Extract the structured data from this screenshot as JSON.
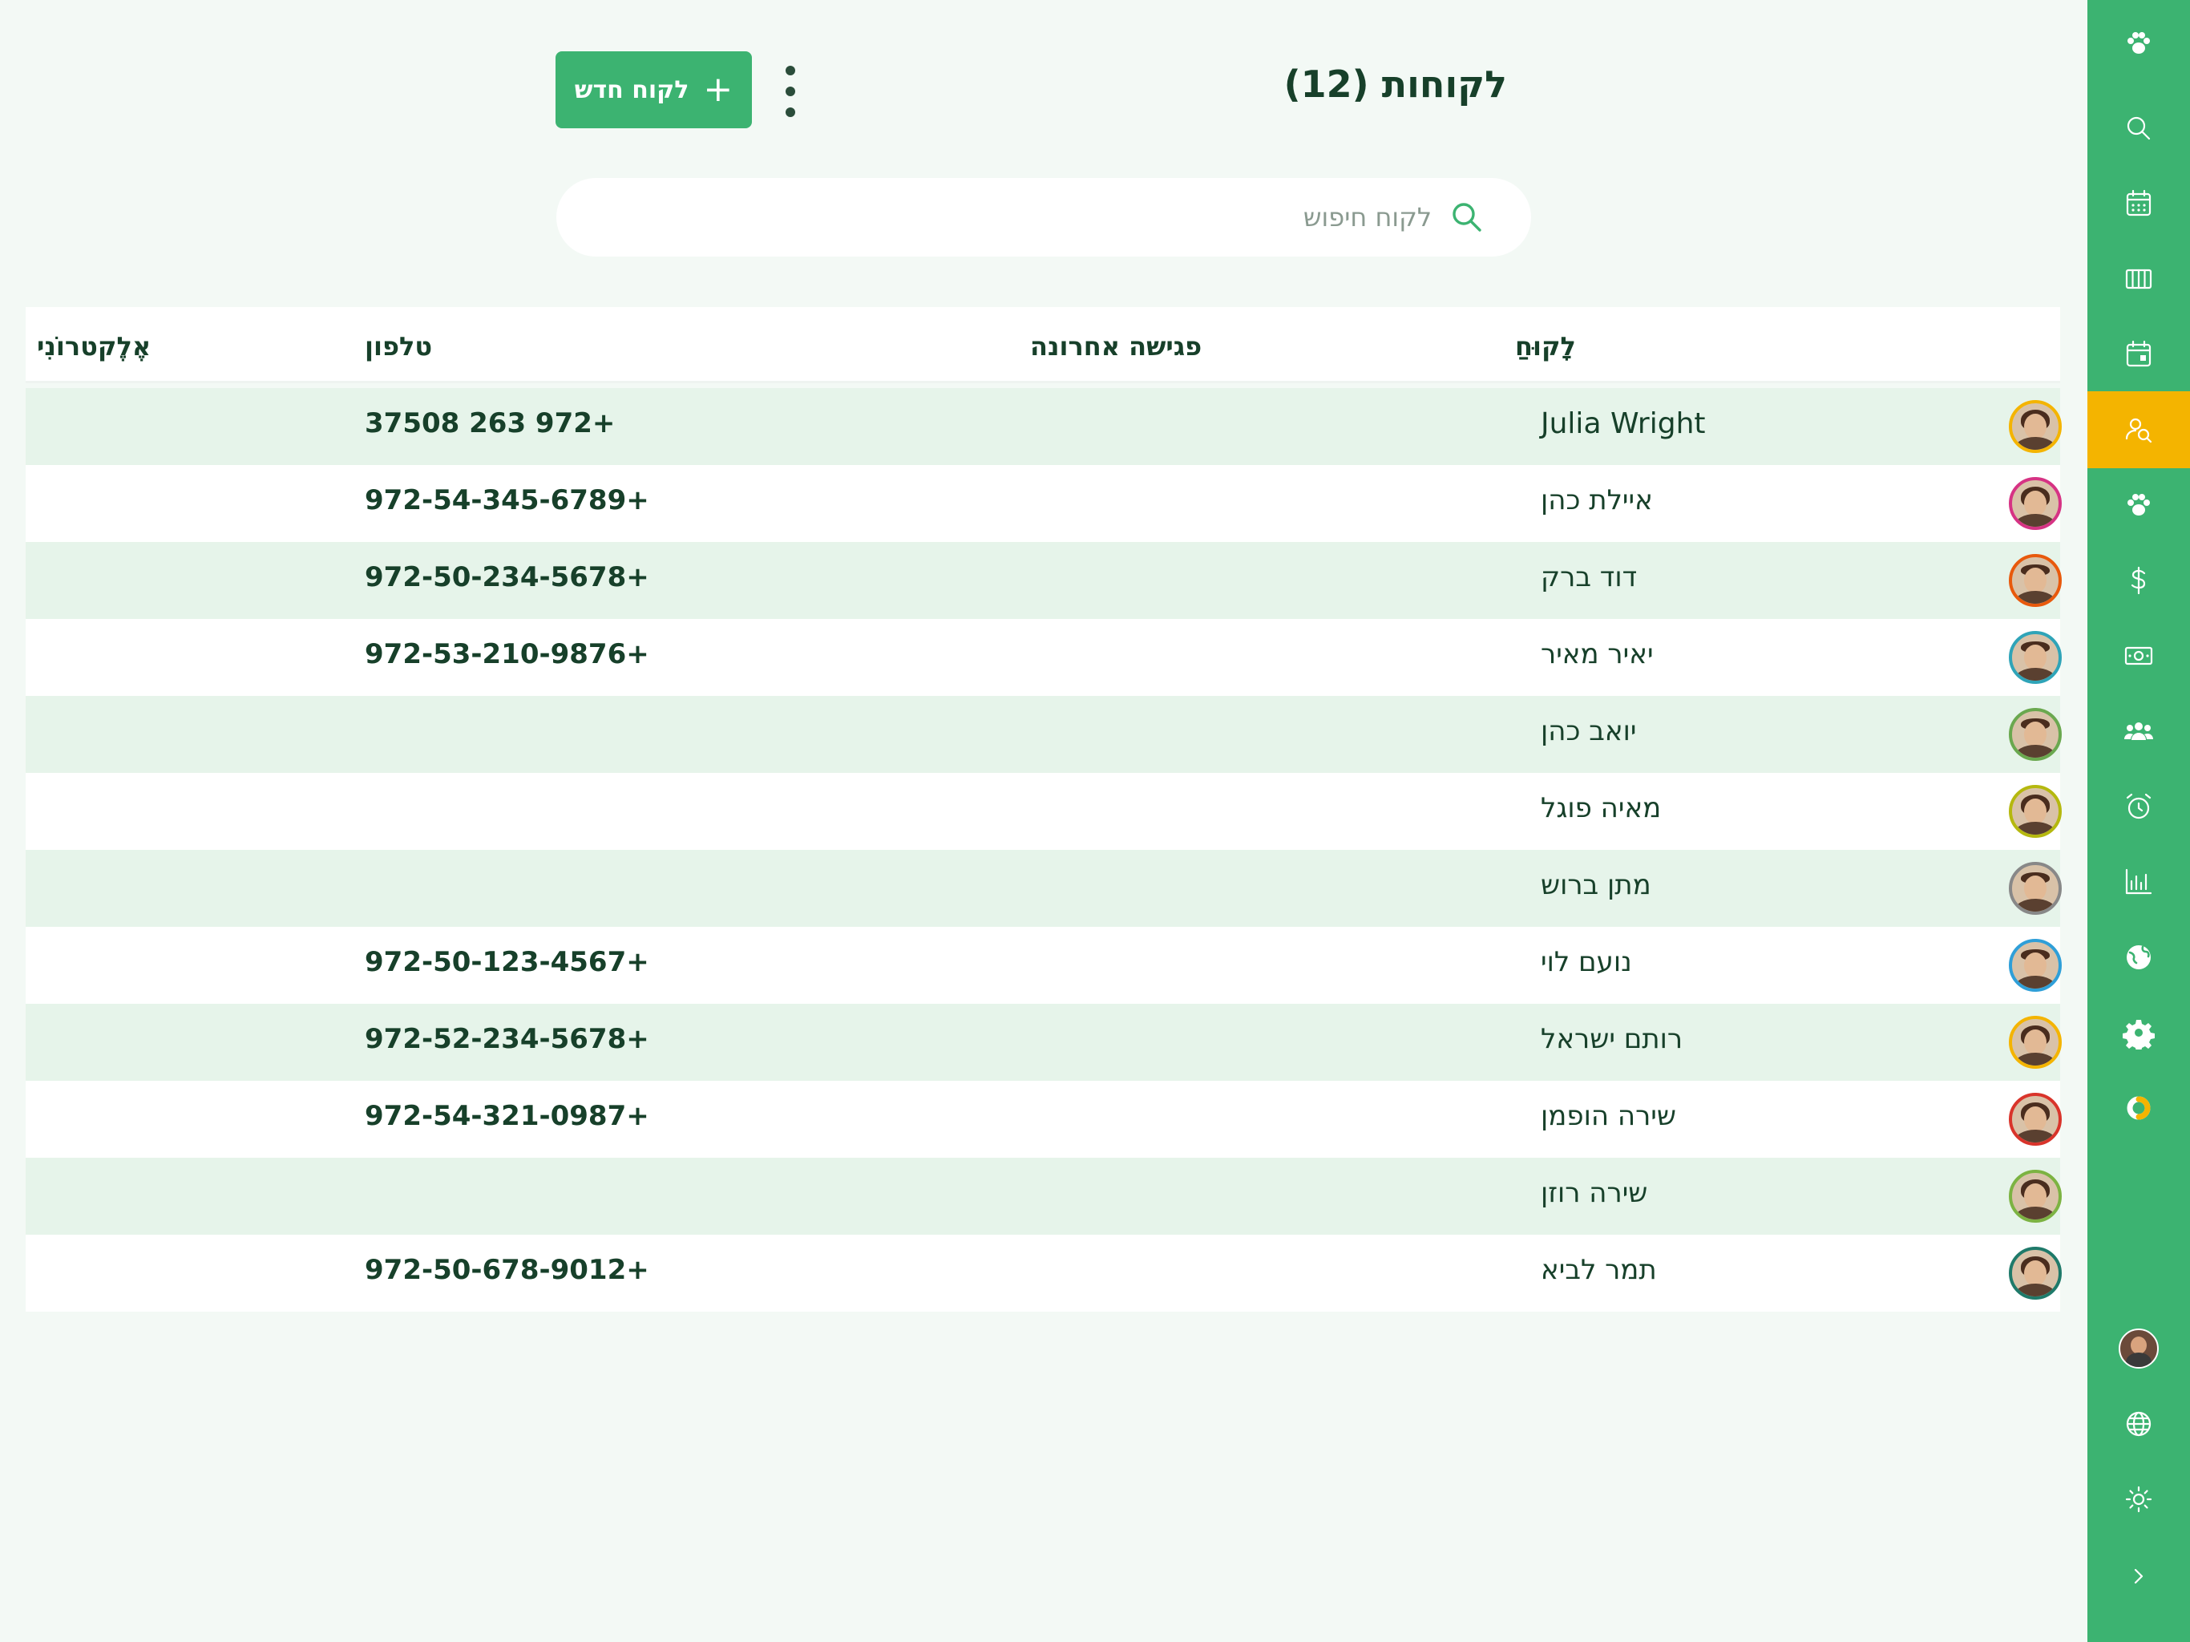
{
  "header": {
    "title": "לקוחות",
    "count": "(12)",
    "new_button_label": "לקוח חדש",
    "new_button_icon": "plus-icon",
    "more_icon": "kebab-menu-icon"
  },
  "search": {
    "placeholder": "לקוח חיפוש",
    "value": "",
    "icon": "search-icon"
  },
  "table": {
    "columns": {
      "customer": "לָקוּחַ",
      "last_meeting": "פגישה אחרונה",
      "phone": "טלפון",
      "email": "אֶלֶקטרוֹנִי"
    },
    "rows": [
      {
        "name": "Julia Wright",
        "phone": "37508 263 972+",
        "last_meeting": "",
        "email": "",
        "avatar_ring": "#f4b400",
        "gender": "female"
      },
      {
        "name": "איילת כהן",
        "phone": "972-54-345-6789+",
        "last_meeting": "",
        "email": "",
        "avatar_ring": "#d63384",
        "gender": "female"
      },
      {
        "name": "דוד ברק",
        "phone": "972-50-234-5678+",
        "last_meeting": "",
        "email": "",
        "avatar_ring": "#e8590c",
        "gender": "male"
      },
      {
        "name": "יאיר מאיר",
        "phone": "972-53-210-9876+",
        "last_meeting": "",
        "email": "",
        "avatar_ring": "#2fa4b8",
        "gender": "male"
      },
      {
        "name": "יואב כהן",
        "phone": "",
        "last_meeting": "",
        "email": "",
        "avatar_ring": "#6aa84f",
        "gender": "male"
      },
      {
        "name": "מאיה פוגל",
        "phone": "",
        "last_meeting": "",
        "email": "",
        "avatar_ring": "#b5b80f",
        "gender": "female"
      },
      {
        "name": "מתן ברוש",
        "phone": "",
        "last_meeting": "",
        "email": "",
        "avatar_ring": "#888888",
        "gender": "male"
      },
      {
        "name": "נועם לוי",
        "phone": "972-50-123-4567+",
        "last_meeting": "",
        "email": "",
        "avatar_ring": "#2f9fd8",
        "gender": "male"
      },
      {
        "name": "רותם ישראל",
        "phone": "972-52-234-5678+",
        "last_meeting": "",
        "email": "",
        "avatar_ring": "#f4b400",
        "gender": "female"
      },
      {
        "name": "שירה הופמן",
        "phone": "972-54-321-0987+",
        "last_meeting": "",
        "email": "",
        "avatar_ring": "#d9342b",
        "gender": "female"
      },
      {
        "name": "שירה רוזן",
        "phone": "",
        "last_meeting": "",
        "email": "",
        "avatar_ring": "#7cb342",
        "gender": "female"
      },
      {
        "name": "תמר לביא",
        "phone": "972-50-678-9012+",
        "last_meeting": "",
        "email": "",
        "avatar_ring": "#1f7a6a",
        "gender": "female"
      }
    ]
  },
  "sidebar": {
    "items": [
      {
        "icon": "paw-icon",
        "active": false
      },
      {
        "icon": "search-icon",
        "active": false
      },
      {
        "icon": "calendar-grid-icon",
        "active": false
      },
      {
        "icon": "columns-icon",
        "active": false
      },
      {
        "icon": "calendar-event-icon",
        "active": false
      },
      {
        "icon": "user-search-icon",
        "active": true
      },
      {
        "icon": "paw-icon",
        "active": false
      },
      {
        "icon": "dollar-icon",
        "active": false
      },
      {
        "icon": "cash-icon",
        "active": false
      },
      {
        "icon": "group-icon",
        "active": false
      },
      {
        "icon": "alarm-icon",
        "active": false
      },
      {
        "icon": "bar-chart-icon",
        "active": false
      },
      {
        "icon": "globe-filled-icon",
        "active": false
      },
      {
        "icon": "gear-icon",
        "active": false
      },
      {
        "icon": "donut-icon",
        "active": false
      }
    ],
    "bottom": [
      {
        "icon": "profile-avatar"
      },
      {
        "icon": "language-globe-icon"
      },
      {
        "icon": "sun-icon"
      },
      {
        "icon": "chevron-right-icon"
      }
    ]
  },
  "colors": {
    "primary": "#3cb371",
    "active_nav": "#f4b400",
    "row_alt": "#e6f4ea",
    "text": "#17402a",
    "page_bg": "#f3f9f5"
  }
}
